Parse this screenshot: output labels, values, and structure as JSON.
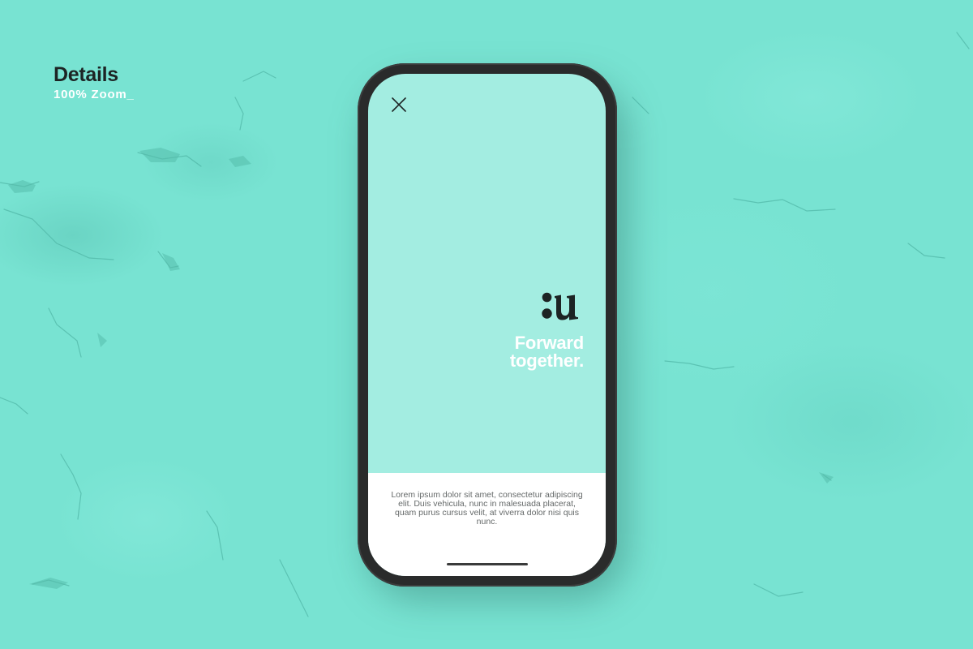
{
  "header": {
    "title": "Details",
    "subtitle": "100% Zoom_"
  },
  "screen": {
    "close_icon": "close-icon",
    "logo_icon": "brand-logo-icon",
    "headline": {
      "line1": "Forward",
      "line2": "together."
    },
    "body_text": "Lorem ipsum dolor sit amet, consectetur adipiscing elit. Duis vehicula, nunc in malesuada placerat, quam purus cursus velit, at viverra dolor nisi quis nunc."
  },
  "colors": {
    "background": "#78e3d2",
    "screen": "#a3ede1",
    "phone_frame": "#2a2b2b",
    "footer_panel": "#ffffff",
    "dark_text": "#1d2424"
  }
}
